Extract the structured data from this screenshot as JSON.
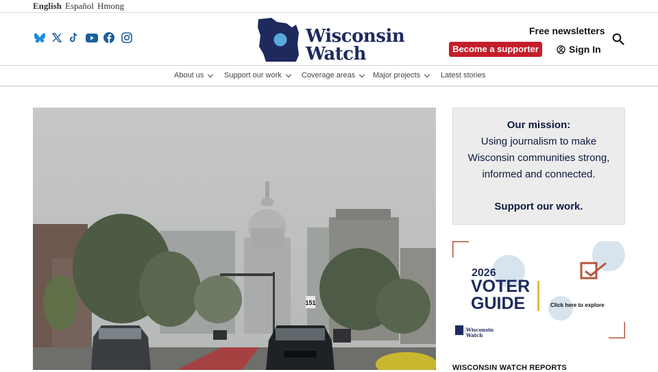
{
  "languages": [
    "English",
    "Español",
    "Hmong"
  ],
  "social": [
    "bluesky-icon",
    "x-icon",
    "tiktok-icon",
    "youtube-icon",
    "facebook-icon",
    "instagram-icon"
  ],
  "logo": {
    "line1": "Wisconsin",
    "line2": "Watch"
  },
  "header": {
    "newsletters": "Free newsletters",
    "supporter": "Become a supporter",
    "signin": "Sign In"
  },
  "nav": [
    "About us",
    "Support our work",
    "Coverage areas",
    "Major projects",
    "Latest stories"
  ],
  "mission": {
    "heading": "Our mission:",
    "lines": [
      "Using journalism to make",
      "Wisconsin communities strong,",
      "informed and connected."
    ],
    "cta": "Support our work."
  },
  "voter": {
    "year": "2026",
    "title1": "VOTER",
    "title2": "GUIDE",
    "explore": "Click here to explore",
    "brand1": "Wisconsin",
    "brand2": "Watch"
  },
  "photo": {
    "sign": "151"
  },
  "reports": "WISCONSIN WATCH REPORTS",
  "colors": {
    "brand_navy": "#1e2a5e",
    "accent_red": "#c41e2a",
    "social_blue": "#1c5e9c",
    "voter_rust": "#b5553b"
  }
}
